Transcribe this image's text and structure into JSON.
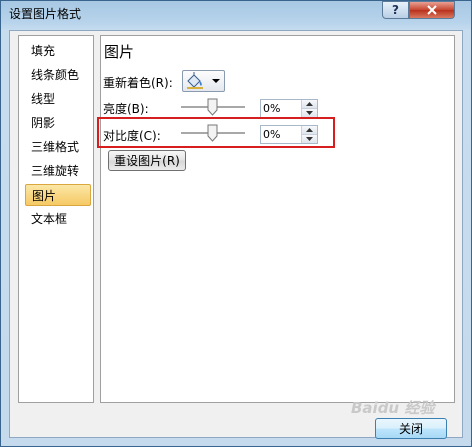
{
  "window": {
    "title": "设置图片格式"
  },
  "nav": {
    "items": [
      {
        "label": "填充"
      },
      {
        "label": "线条颜色"
      },
      {
        "label": "线型"
      },
      {
        "label": "阴影"
      },
      {
        "label": "三维格式"
      },
      {
        "label": "三维旋转"
      },
      {
        "label": "图片",
        "selected": true
      },
      {
        "label": "文本框"
      }
    ]
  },
  "panel": {
    "title": "图片",
    "recolor_label": "重新着色(R):",
    "brightness_label": "亮度(B):",
    "brightness_value": "0%",
    "contrast_label": "对比度(C):",
    "contrast_value": "0%",
    "reset_label": "重设图片(R)"
  },
  "footer": {
    "close_label": "关闭"
  },
  "watermark": "Baidu 经验",
  "colors": {
    "highlight": "#d71e1e",
    "selected_bg": "#f6c965",
    "titlebar": "#a7c7e3"
  }
}
